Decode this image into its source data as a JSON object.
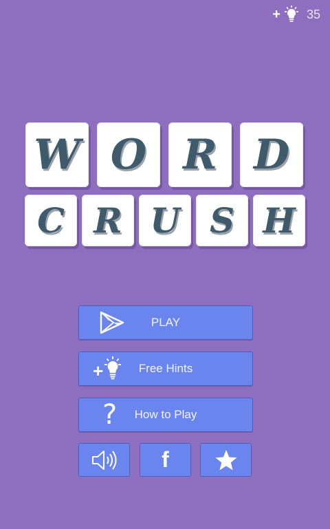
{
  "hints": {
    "count": "35",
    "plus": "+"
  },
  "title": {
    "row1": [
      "W",
      "O",
      "R",
      "D"
    ],
    "row2": [
      "C",
      "R",
      "U",
      "S",
      "H"
    ]
  },
  "menu": {
    "play_label": "PLAY",
    "free_hints_label": "Free Hints",
    "free_hints_plus": "+",
    "how_to_play_label": "How to Play",
    "how_to_play_glyph": "?"
  },
  "bottom": {
    "facebook_glyph": "f"
  },
  "colors": {
    "background": "#8e6fbf",
    "button": "#6a86ee",
    "tile": "#ffffff",
    "letter": "#3f5a6b"
  },
  "icons": [
    "lightbulb-icon",
    "play-store-icon",
    "question-icon",
    "speaker-icon",
    "facebook-icon",
    "star-icon"
  ]
}
